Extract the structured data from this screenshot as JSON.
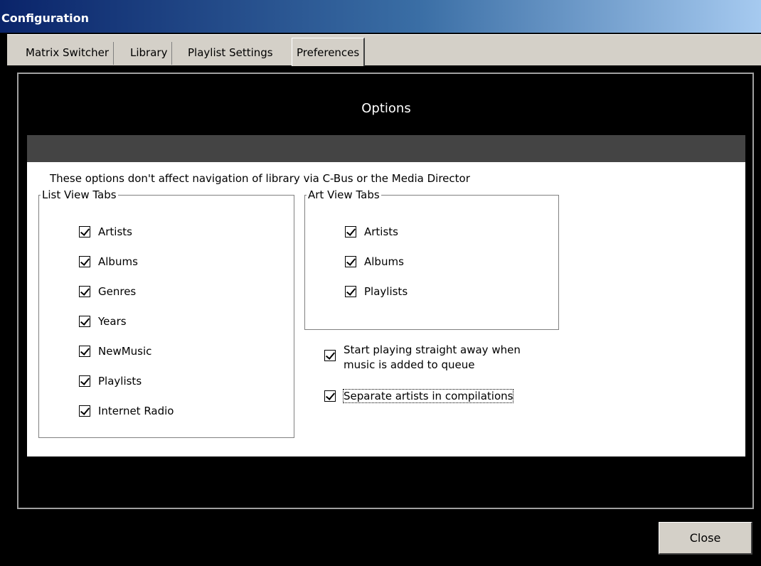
{
  "window": {
    "title": "Configuration"
  },
  "tabs": [
    {
      "label": "Matrix Switcher"
    },
    {
      "label": "Library"
    },
    {
      "label": "Playlist Settings"
    },
    {
      "label": "Preferences",
      "active": true
    }
  ],
  "options": {
    "header": "Options",
    "info_text": "These options don't affect navigation of library via C-Bus or the Media Director",
    "list_view": {
      "legend": "List View Tabs",
      "items": [
        {
          "label": "Artists",
          "checked": true
        },
        {
          "label": "Albums",
          "checked": true
        },
        {
          "label": "Genres",
          "checked": true
        },
        {
          "label": "Years",
          "checked": true
        },
        {
          "label": "NewMusic",
          "checked": true
        },
        {
          "label": "Playlists",
          "checked": true
        },
        {
          "label": "Internet Radio",
          "checked": true
        }
      ]
    },
    "art_view": {
      "legend": "Art View Tabs",
      "items": [
        {
          "label": "Artists",
          "checked": true
        },
        {
          "label": "Albums",
          "checked": true
        },
        {
          "label": "Playlists",
          "checked": true
        }
      ]
    },
    "start_playing": {
      "line1": "Start playing straight away when",
      "line2": "music is added to queue",
      "checked": true
    },
    "separate_artists": {
      "label": "Separate artists in compilations",
      "checked": true
    }
  },
  "buttons": {
    "close": "Close"
  }
}
